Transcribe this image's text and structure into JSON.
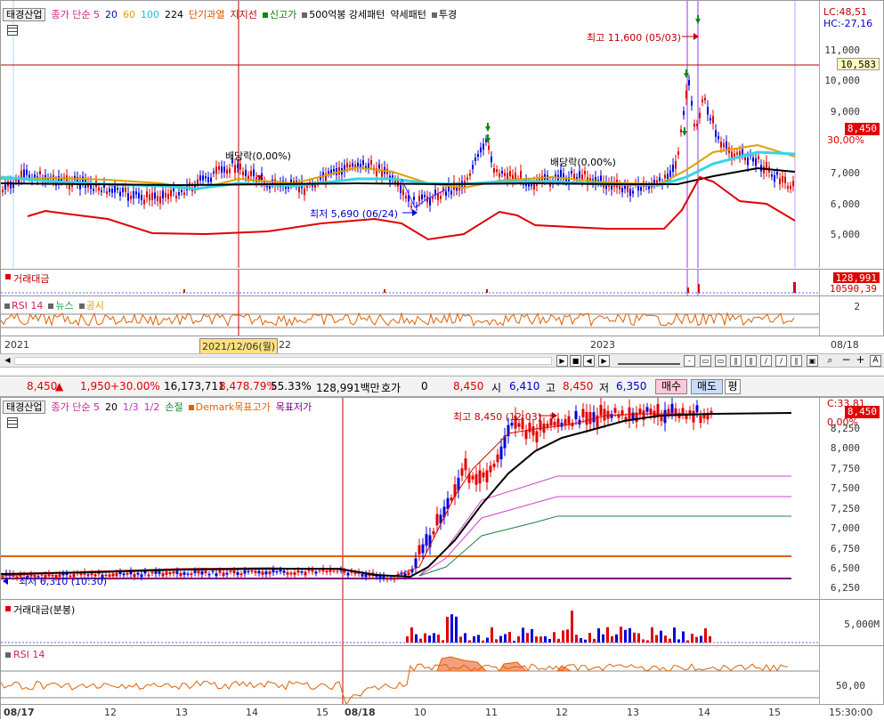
{
  "top_chart": {
    "legend": {
      "stock": "태경산업",
      "ma_label": "종가 단순 5",
      "ma20": "20",
      "ma60": "60",
      "ma100": "100",
      "ma224": "224",
      "envelope": "단기과열",
      "support": "지지선",
      "new_high": "신고가",
      "pattern": "500억봉 강세패턴",
      "weak": "약세패턴",
      "trans": "투경"
    },
    "right_top": {
      "lc": "LC:48,51",
      "hc": "HC:-27,16"
    },
    "y_labels": [
      "11,000",
      "10,000",
      "9,000",
      "8,000",
      "7,000",
      "6,000",
      "5,000"
    ],
    "price_tags": {
      "ref": "10,583",
      "price": "8,450",
      "pct": "30,00%"
    },
    "annotations": {
      "high": "최고 11,600 (05/03)",
      "low": "최저 5,690 (06/24)",
      "div1": "배당락(0,00%)",
      "div2": "배당락(0,00%)"
    },
    "volume_label": "거래대금",
    "volume_tags": {
      "v1": "128,991",
      "v2": "10590,39"
    },
    "rsi_legend": {
      "rsi": "RSI 14",
      "news": "뉴스",
      "notice": "공시"
    },
    "rsi_tag": "2",
    "x_labels": {
      "a": "2021",
      "b": "2021/12/06(월)",
      "c": "22",
      "d": "2023",
      "e": "08/18"
    }
  },
  "info_bar": {
    "price": "8,450",
    "change": "1,950",
    "pct": "+30.00%",
    "volume": "16,173,711",
    "vol_pct": "8,478.79%",
    "ratio": "55.33%",
    "amount": "128,991백만",
    "bid_label": "호가",
    "bid_value": "0",
    "bid_price": "8,450",
    "open_label": "시",
    "open": "6,410",
    "high_label": "고",
    "high": "8,450",
    "low_label": "저",
    "low": "6,350",
    "buy": "매수",
    "sell": "매도",
    "eval": "평"
  },
  "bottom_chart": {
    "legend": {
      "stock": "태경산업",
      "ma_label": "종가 단순 5",
      "ma20": "20",
      "f13": "1/3",
      "f12": "1/2",
      "stop": "손절",
      "demark_high": "Demark목표고가",
      "demark_low": "목표저가"
    },
    "right_top": "C:33,81",
    "y_labels": [
      "8,250",
      "8,000",
      "7,750",
      "7,500",
      "7,250",
      "7,000",
      "6,750",
      "6,500",
      "6,250"
    ],
    "price_tags": {
      "price": "8,450",
      "pct": "0,00%"
    },
    "annotations": {
      "high": "최고 8,450 (12:03)",
      "low": "최저 6,310 (10:30)"
    },
    "volume_label": "거래대금(분봉)",
    "volume_y": "5,000M",
    "rsi_label": "RSI 14",
    "rsi_y": "50,00",
    "x_labels": [
      "08/17",
      "12",
      "13",
      "14",
      "15",
      "08/18",
      "10",
      "11",
      "12",
      "13",
      "14",
      "15"
    ],
    "time": "15:30:00"
  }
}
